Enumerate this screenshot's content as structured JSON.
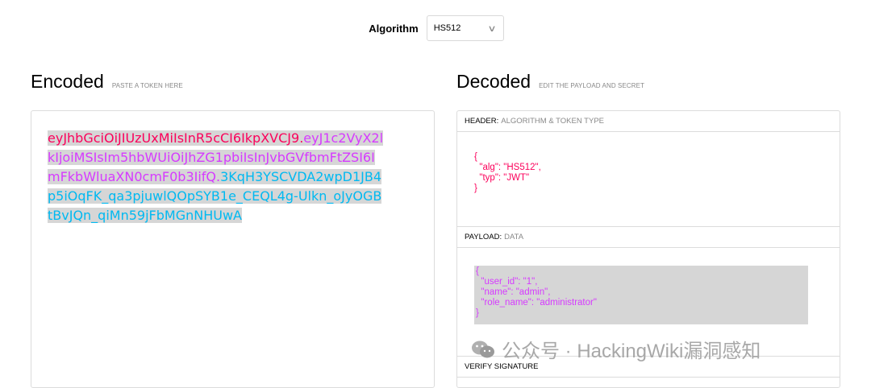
{
  "algorithm": {
    "label": "Algorithm",
    "selected": "HS512"
  },
  "encoded": {
    "title": "Encoded",
    "subtitle": "PASTE A TOKEN HERE",
    "token_header": "eyJhbGciOiJIUzUxMiIsInR5cCI6IkpXVCJ9",
    "dot1": ".",
    "token_payload": "eyJ1c2VyX2lkIjoiMSIsIm5hbWUiOiJhZG1pbiIsInJvbGVfbmFtZSI6ImFkbWluaXN0cmF0b3IifQ",
    "dot2": ".",
    "token_signature": "3KqH3YSCVDA2wpD1JB4p5iOqFK_qa3pjuwlQOpSYB1e_CEQL4g-Ulkn_oJyOGBtBvJQn_qiMn59jFbMGnNHUwA",
    "colors": {
      "header": "#fb015b",
      "payload": "#d63aff",
      "signature": "#00b9f1"
    }
  },
  "decoded": {
    "title": "Decoded",
    "subtitle": "EDIT THE PAYLOAD AND SECRET",
    "header_section": {
      "label": "HEADER:",
      "sublabel": "ALGORITHM & TOKEN TYPE",
      "lines": [
        "{",
        "  \"alg\": \"HS512\",",
        "  \"typ\": \"JWT\"",
        "}"
      ]
    },
    "payload_section": {
      "label": "PAYLOAD:",
      "sublabel": "DATA",
      "lines": [
        "{",
        "  \"user_id\": \"1\",",
        "  \"name\": \"admin\",",
        "  \"role_name\": \"administrator\"",
        "}"
      ]
    },
    "verify_section": {
      "label": "VERIFY SIGNATURE"
    }
  },
  "watermark": {
    "icon": "wechat-icon",
    "text": "公众号 · HackingWiki漏洞感知"
  }
}
